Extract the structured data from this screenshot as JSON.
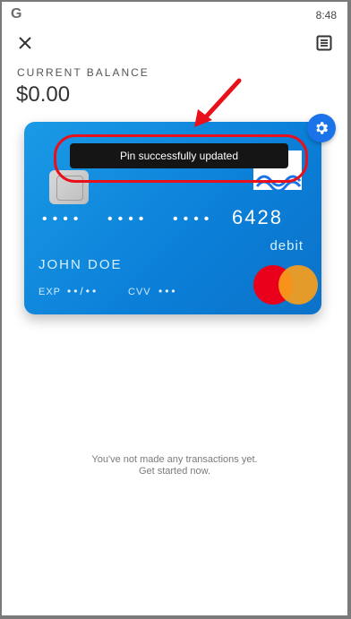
{
  "status_bar": {
    "app_icon": "G",
    "time": "8:48"
  },
  "header": {
    "close_icon": "close-icon",
    "menu_icon": "list-icon"
  },
  "balance": {
    "label": "CURRENT BALANCE",
    "value": "$0.00"
  },
  "card": {
    "dots_group": "••••",
    "last4": "6428",
    "type": "debit",
    "holder_name": "JOHN DOE",
    "exp_label": "EXP",
    "exp_value": "••/••",
    "cvv_label": "CVV",
    "cvv_value": "•••",
    "network": "mastercard",
    "colors": {
      "card_top": "#1a9ae6",
      "card_bottom": "#0c72c9",
      "mc_red": "#eb001b",
      "mc_orange": "#f79e1b"
    }
  },
  "toast": {
    "message": "Pin successfully updated"
  },
  "empty_state": {
    "line1": "You've not made any transactions yet.",
    "line2": "Get started now."
  },
  "colors": {
    "annotation": "#e8101a",
    "settings_button": "#1a73e8"
  }
}
